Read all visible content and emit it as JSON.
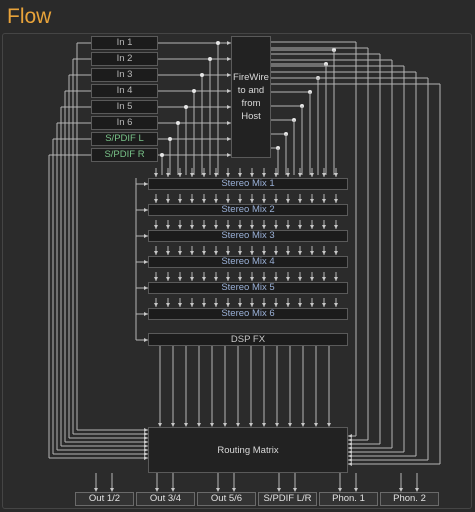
{
  "title": "Flow",
  "inputs": [
    "In 1",
    "In 2",
    "In 3",
    "In 4",
    "In 5",
    "In 6",
    "S/PDIF L",
    "S/PDIF R"
  ],
  "firewire": {
    "line1": "FireWire",
    "line2": "to and",
    "line3": "from",
    "line4": "Host"
  },
  "mixes": [
    "Stereo Mix 1",
    "Stereo Mix 2",
    "Stereo Mix 3",
    "Stereo Mix 4",
    "Stereo Mix 5",
    "Stereo Mix 6"
  ],
  "dsp": "DSP FX",
  "routing": "Routing Matrix",
  "outputs": [
    "Out 1/2",
    "Out 3/4",
    "Out 5/6",
    "S/PDIF L/R",
    "Phon. 1",
    "Phon. 2"
  ],
  "colors": {
    "accent": "#e8a33a",
    "mix_text": "#9ab0d6",
    "spdif_text": "#79c389"
  }
}
